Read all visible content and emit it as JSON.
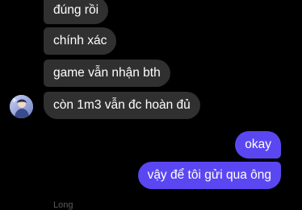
{
  "conversation": {
    "messages": [
      {
        "direction": "incoming",
        "text": "đúng rồi"
      },
      {
        "direction": "incoming",
        "text": "chính xác"
      },
      {
        "direction": "incoming",
        "text": "game vẫn nhận bth"
      },
      {
        "direction": "incoming",
        "text": "còn 1m3 vẫn đc hoàn đủ"
      },
      {
        "direction": "outgoing",
        "text": "okay"
      },
      {
        "direction": "outgoing",
        "text": "vậy để tôi gửi qua ông"
      }
    ],
    "footer_name": "Long"
  },
  "colors": {
    "background": "#000000",
    "incoming_bubble": "#303030",
    "outgoing_bubble": "#5b47f2",
    "text": "#ffffff"
  },
  "icons": {
    "sender_avatar": "user-avatar-icon"
  }
}
